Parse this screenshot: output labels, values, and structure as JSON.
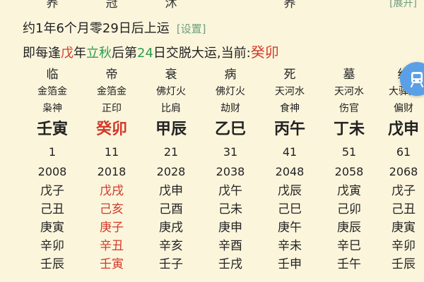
{
  "top_row": [
    "养",
    "冠",
    "沐",
    "养"
  ],
  "expand_label": "[展开]",
  "line1": {
    "text": "约1年6个月零29日后上运",
    "settings": "[设置]"
  },
  "line2": {
    "prefix": "即每逢",
    "stem": "戊",
    "mid1": "年",
    "solar_term": "立秋",
    "mid2": "后第",
    "day": "24",
    "suffix": "日交脱大运,当前:",
    "current": "癸卯"
  },
  "columns": [
    {
      "stage": "临",
      "nayin": "金箔金",
      "god": "枭神",
      "pillar": "壬寅",
      "age": "1",
      "year": "2008",
      "years": [
        "戊子",
        "己丑",
        "庚寅",
        "辛卯",
        "壬辰"
      ],
      "current": false
    },
    {
      "stage": "帝",
      "nayin": "金箔金",
      "god": "正印",
      "pillar": "癸卯",
      "age": "11",
      "year": "2018",
      "years": [
        "戊戌",
        "己亥",
        "庚子",
        "辛丑",
        "壬寅"
      ],
      "current": true
    },
    {
      "stage": "衰",
      "nayin": "佛灯火",
      "god": "比肩",
      "pillar": "甲辰",
      "age": "21",
      "year": "2028",
      "years": [
        "戊申",
        "己酉",
        "庚戌",
        "辛亥",
        "壬子"
      ],
      "current": false
    },
    {
      "stage": "病",
      "nayin": "佛灯火",
      "god": "劫财",
      "pillar": "乙巳",
      "age": "31",
      "year": "2038",
      "years": [
        "戊午",
        "己未",
        "庚申",
        "辛酉",
        "壬戌"
      ],
      "current": false
    },
    {
      "stage": "死",
      "nayin": "天河水",
      "god": "食神",
      "pillar": "丙午",
      "age": "41",
      "year": "2048",
      "years": [
        "戊辰",
        "己巳",
        "庚午",
        "辛未",
        "壬申"
      ],
      "current": false
    },
    {
      "stage": "墓",
      "nayin": "天河水",
      "god": "伤官",
      "pillar": "丁未",
      "age": "51",
      "year": "2058",
      "years": [
        "戊寅",
        "己卯",
        "庚辰",
        "辛巳",
        "壬午"
      ],
      "current": false
    },
    {
      "stage": "绝",
      "nayin": "大驿土",
      "god": "偏财",
      "pillar": "戊申",
      "age": "61",
      "year": "2068",
      "years": [
        "戊子",
        "己丑",
        "庚寅",
        "辛卯",
        "壬辰"
      ],
      "current": false
    }
  ],
  "colors": {
    "background": "#fbf5dc",
    "accent_red": "#d23a2a",
    "accent_green": "#2f9a4e",
    "link": "#6aa07e",
    "float_button": "#5aa0e6"
  },
  "icons": {
    "float_button": "subway-train-icon"
  }
}
